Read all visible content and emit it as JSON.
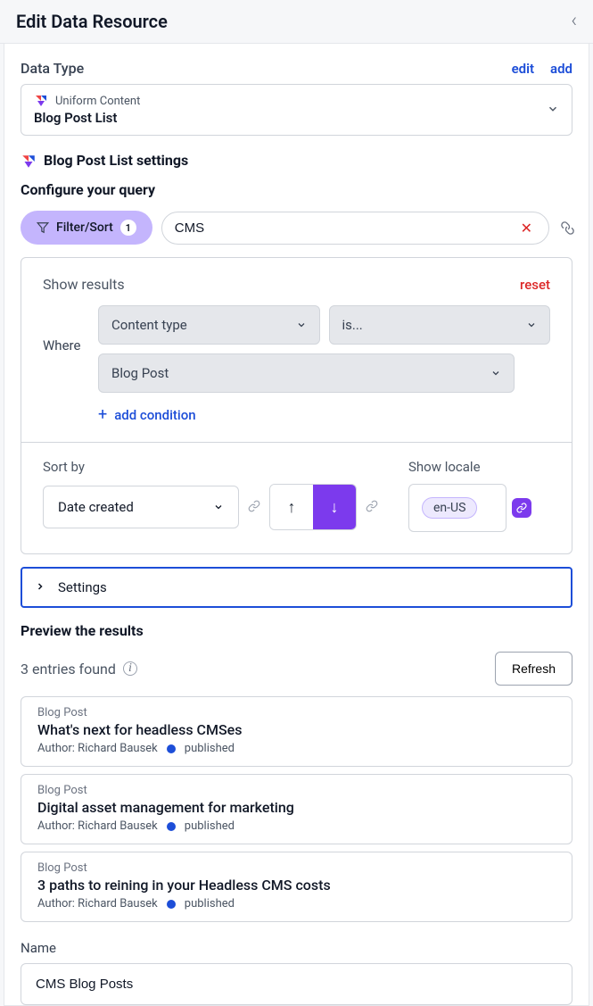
{
  "header": {
    "title": "Edit Data Resource"
  },
  "dataType": {
    "section_label": "Data Type",
    "edit": "edit",
    "add": "add",
    "top_label": "Uniform Content",
    "main_label": "Blog Post List"
  },
  "settings_heading": "Blog Post List settings",
  "query": {
    "label": "Configure your query",
    "filter_label": "Filter/Sort",
    "filter_count": "1",
    "search_value": "CMS"
  },
  "results": {
    "show_label": "Show results",
    "reset": "reset",
    "where_label": "Where",
    "field_select": "Content type",
    "op_select": "is...",
    "value_select": "Blog Post",
    "add_condition": "add condition"
  },
  "sort": {
    "label": "Sort by",
    "value": "Date created",
    "locale_label": "Show locale",
    "locale": "en-US"
  },
  "settings_accordion": "Settings",
  "preview": {
    "title": "Preview the results",
    "count_text": "3 entries found",
    "refresh": "Refresh",
    "entries": [
      {
        "type": "Blog Post",
        "title": "What's next for headless CMSes",
        "author": "Author: Richard Bausek",
        "status": "published"
      },
      {
        "type": "Blog Post",
        "title": "Digital asset management for marketing",
        "author": "Author: Richard Bausek",
        "status": "published"
      },
      {
        "type": "Blog Post",
        "title": "3 paths to reining in your Headless CMS costs",
        "author": "Author: Richard Bausek",
        "status": "published"
      }
    ]
  },
  "name": {
    "label": "Name",
    "value": "CMS Blog Posts"
  }
}
